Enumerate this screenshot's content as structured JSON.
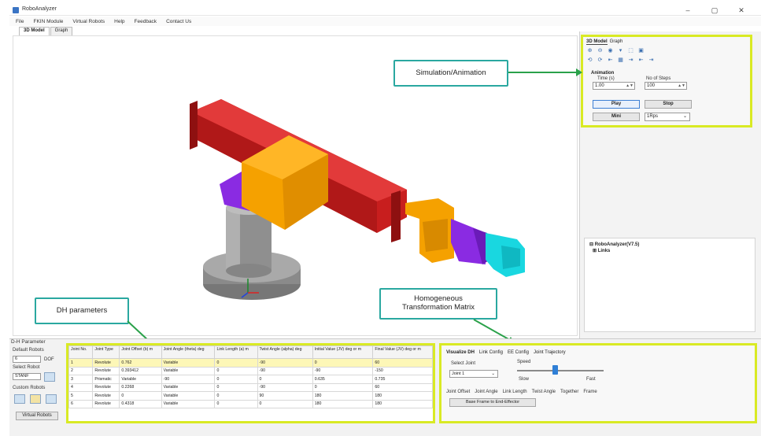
{
  "window": {
    "title": "RoboAnalyzer",
    "minimize": "–",
    "maximize": "▢",
    "close": "✕"
  },
  "menu": [
    "File",
    "FKIN Module",
    "Virtual Robots",
    "Help",
    "Feedback",
    "Contact Us"
  ],
  "view_tabs": [
    "3D Model",
    "Graph"
  ],
  "controls": {
    "tabs": [
      "3D Model",
      "Graph"
    ],
    "toolbar_row1": [
      "⊕",
      "⊖",
      "◉",
      "▾",
      "⬚",
      "▣"
    ],
    "toolbar_row2": [
      "⟲",
      "⟳",
      "⇤",
      "▦",
      "⇥",
      "⇤",
      "⇥"
    ],
    "animation_title": "Animation",
    "time_label": "Time (s)",
    "steps_label": "No of Steps",
    "time_value": "1.00",
    "steps_value": "100",
    "play_button": "Play",
    "stop_button": "Stop",
    "mini_button": "Mini",
    "speed_select": "1Rps"
  },
  "tree": {
    "items": [
      "RoboAnalyzer(V7.5)",
      "Links"
    ]
  },
  "callouts": {
    "simulation": "Simulation/Animation",
    "dh": "DH parameters",
    "htm_line1": "Homogeneous",
    "htm_line2": "Transformation Matrix"
  },
  "side": {
    "title": "D-H Parameter",
    "default_robots_label": "Default Robots",
    "dof_value": "6",
    "dof_label": "DOF",
    "select_robot_label": "Select Robot",
    "robot_value": "STANF",
    "custom_robots_label": "Custom Robots",
    "virtual_robots_button": "Virtual Robots"
  },
  "dh_table": {
    "headers": [
      "Joint No.",
      "Joint Type",
      "Joint Offset (b) m",
      "Joint Angle (theta) deg",
      "Link Length (a) m",
      "Twist Angle (alpha) deg",
      "Initial Value (JV) deg or m",
      "Final Value (JV) deg or m"
    ],
    "rows": [
      [
        "1",
        "Revolute",
        "0.762",
        "Variable",
        "0",
        "-90",
        "0",
        "60"
      ],
      [
        "2",
        "Revolute",
        "0.393412",
        "Variable",
        "0",
        "-90",
        "-90",
        "-150"
      ],
      [
        "3",
        "Prismatic",
        "Variable",
        "-90",
        "0",
        "0",
        "0.635",
        "0.735"
      ],
      [
        "4",
        "Revolute",
        "0.2268",
        "Variable",
        "0",
        "-90",
        "0",
        "60"
      ],
      [
        "5",
        "Revolute",
        "0",
        "Variable",
        "0",
        "90",
        "180",
        "180"
      ],
      [
        "6",
        "Revolute",
        "0.4318",
        "Variable",
        "0",
        "0",
        "180",
        "180"
      ]
    ]
  },
  "htm": {
    "tabs": [
      "Visualize DH",
      "Link Config",
      "EE Config",
      "Joint Trajectory"
    ],
    "select_joint_label": "Select Joint",
    "joint_value": "Joint 1",
    "speed_label": "Speed",
    "slow_label": "Slow",
    "fast_label": "Fast",
    "params": [
      "Joint Offset",
      "Joint Angle",
      "Link Length",
      "Twist Angle",
      "Together",
      "Frame"
    ],
    "base_button": "Base Frame to End-Effector"
  }
}
